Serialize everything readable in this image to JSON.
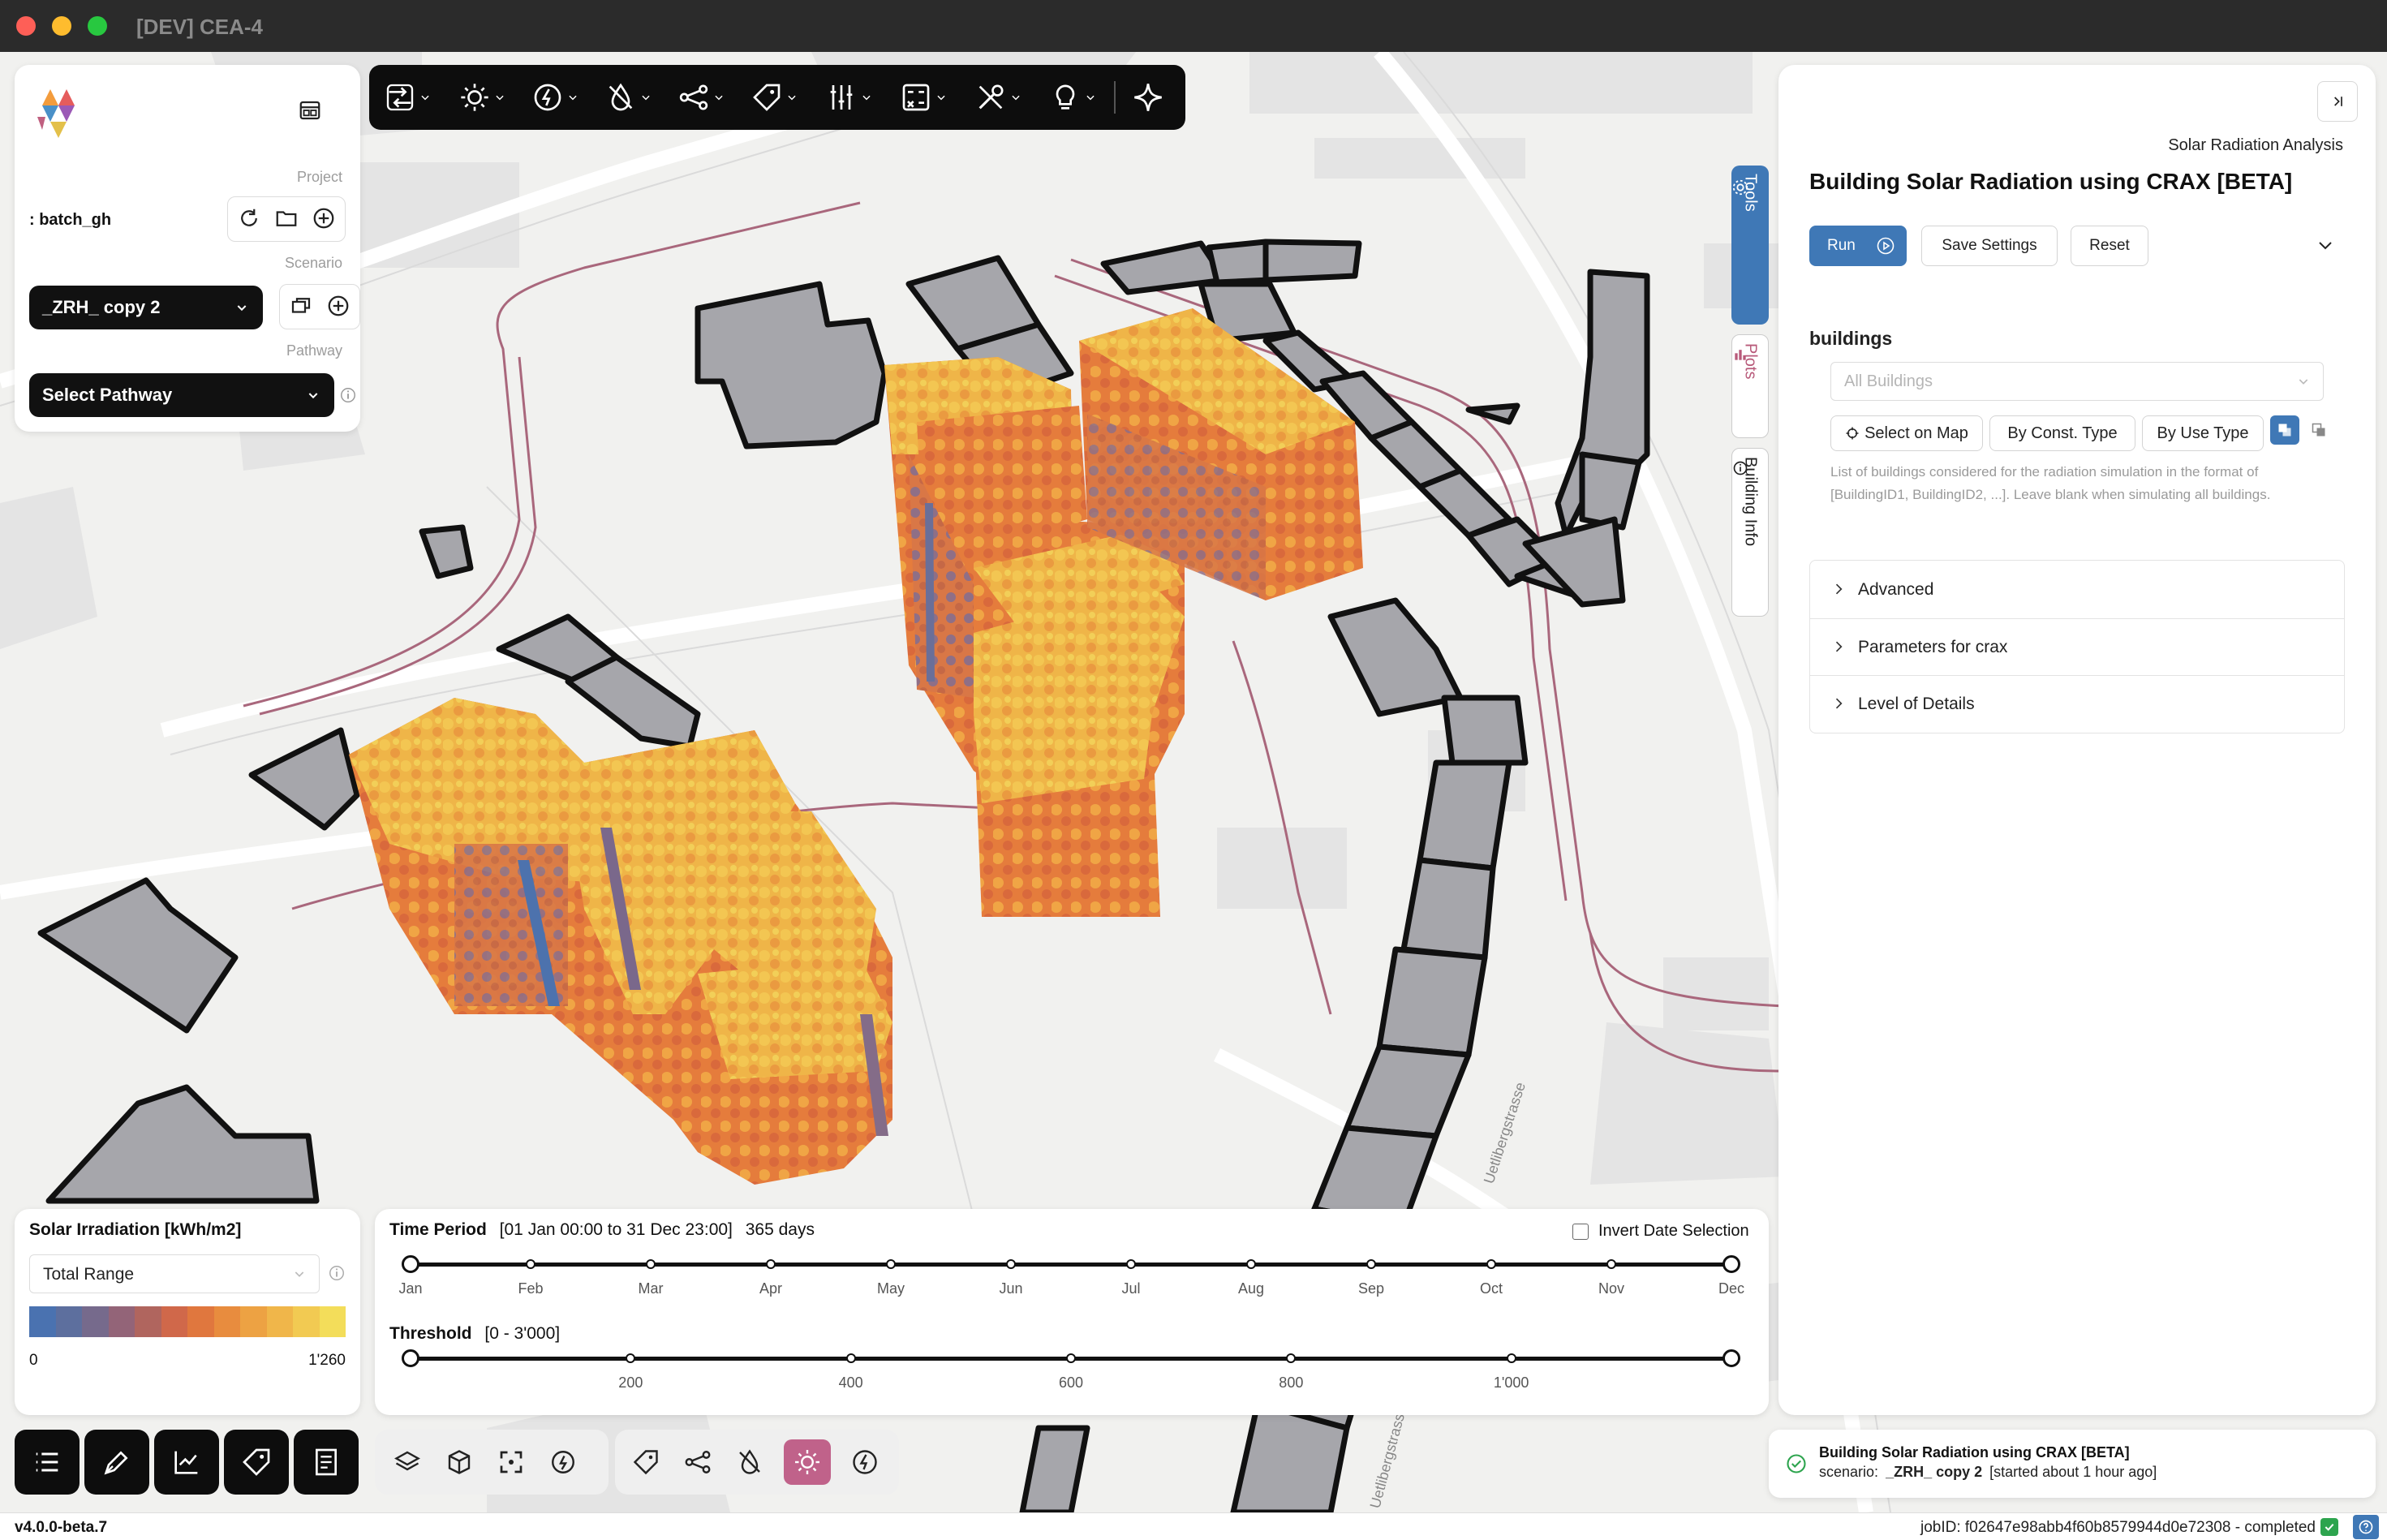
{
  "window": {
    "title": "[DEV] CEA-4"
  },
  "project_panel": {
    "project_label": "Project",
    "project_name": ": batch_gh",
    "scenario_label": "Scenario",
    "scenario_value": "_ZRH_ copy 2",
    "pathway_label": "Pathway",
    "pathway_value": "Select Pathway"
  },
  "toolbar": {
    "items": [
      "import-export",
      "solar",
      "energy",
      "water",
      "network",
      "buildings",
      "settings",
      "calculator",
      "tools",
      "ideas",
      "ai"
    ]
  },
  "right_panel": {
    "category": "Solar Radiation Analysis",
    "title": "Building Solar Radiation using CRAX [BETA]",
    "run_label": "Run",
    "save_label": "Save Settings",
    "reset_label": "Reset",
    "buildings_heading": "buildings",
    "buildings_placeholder": "All Buildings",
    "select_on_map": "Select on Map",
    "by_const_type": "By Const. Type",
    "by_use_type": "By Use Type",
    "help_text": "List of buildings considered for the radiation simulation in the format of [BuildingID1, BuildingID2, ...]. Leave blank when simulating all buildings.",
    "sections": [
      "Advanced",
      "Parameters for crax",
      "Level of Details"
    ]
  },
  "side_tabs": [
    "Tools",
    "Plots",
    "Building Info"
  ],
  "legend": {
    "title": "Solar Irradiation [kWh/m2]",
    "range_mode": "Total Range",
    "min": "0",
    "max": "1'260",
    "colors": [
      "#4a72b0",
      "#5d6f9e",
      "#766a8c",
      "#936478",
      "#b0655e",
      "#d0684a",
      "#e0773e",
      "#e88c3e",
      "#eda243",
      "#f0b64a",
      "#f2ca52",
      "#f3dd5a"
    ]
  },
  "timeline": {
    "time_label": "Time Period",
    "time_range": "[01 Jan 00:00 to 31 Dec 23:00]",
    "days": "365 days",
    "invert_label": "Invert Date Selection",
    "invert_checked": false,
    "months": [
      "Jan",
      "Feb",
      "Mar",
      "Apr",
      "May",
      "Jun",
      "Jul",
      "Aug",
      "Sep",
      "Oct",
      "Nov",
      "Dec"
    ],
    "threshold_label": "Threshold",
    "threshold_range": "[0 - 3'000]",
    "threshold_ticks": [
      "200",
      "400",
      "600",
      "800",
      "1'000"
    ]
  },
  "job": {
    "title": "Building Solar Radiation using CRAX [BETA]",
    "scenario_prefix": "scenario:",
    "scenario_name": "_ZRH_ copy 2",
    "started": "[started about 1 hour ago]"
  },
  "status": {
    "version": "v4.0.0-beta.7",
    "job_info": "jobID: f02647e98abb4f60b8579944d0e72308 - completed"
  },
  "map_labels": [
    "Uetlibergstrasse",
    "Uetlibergstrass"
  ]
}
